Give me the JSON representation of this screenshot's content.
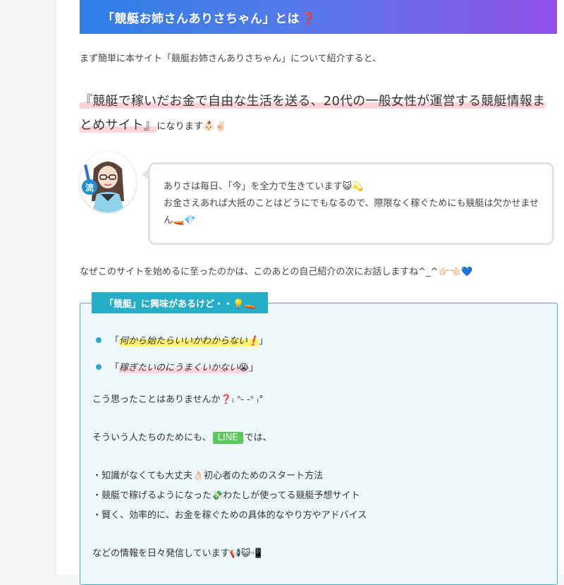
{
  "heading": {
    "text": "「競艇お姉さんありさちゃん」とは",
    "mark": "❓"
  },
  "intro": "まず簡単に本サイト「競艇お姉さんありさちゃん」について紹介すると、",
  "highlight": {
    "text": "『競艇で稼いだお金で自由な生活を送る、20代の一般女性が運営する競艇情報まとめサイト』",
    "tail": "になります👶🏻✌🏻"
  },
  "speech": {
    "line1": "ありさは毎日、「今」を全力で生きています😺💫",
    "line2": "お金さえあれば大抵のことはどうにでもなるので、際限なく稼ぐためにも競艇は欠かせません🚤💎",
    "avatar_badge": "流"
  },
  "why": "なぜこのサイトを始めるに至ったのかは、このあとの自己紹介の次にお話しますね^_^👉🏻👈🏻💙",
  "box": {
    "title": "「競艇」に興味があるけど・・💡🚤",
    "bullet1": {
      "open": "「",
      "text": "何から始たらいいかわからない",
      "mark": "❗",
      "close": "」"
    },
    "bullet2": {
      "open": "「",
      "text": "稼ぎたいのにうまくいかない😭",
      "close": "」"
    },
    "q": "こう思ったことはありませんか❓₍ ᐢ- -ᐢ ₎°",
    "so_pre": "そういう人たちのためにも、",
    "so_badge": "LINE",
    "so_post": "では、",
    "list": [
      "・知識がなくても大丈夫👌🏻初心者のためのスタート方法",
      "・競艇で稼げるようになった💸わたしが使ってる競艇予想サイト",
      "・賢く、効率的に、お金を稼ぐための具体的なやり方やアドバイス"
    ],
    "outro": "などの情報を日々発信しています📢😺📲"
  },
  "colors": {
    "heading_gradient_start": "#2e7fe6",
    "heading_gradient_end": "#9150e8",
    "box_border": "#3bb6cf",
    "box_title_bg": "#26aec9",
    "line_badge": "#5ac85a"
  }
}
